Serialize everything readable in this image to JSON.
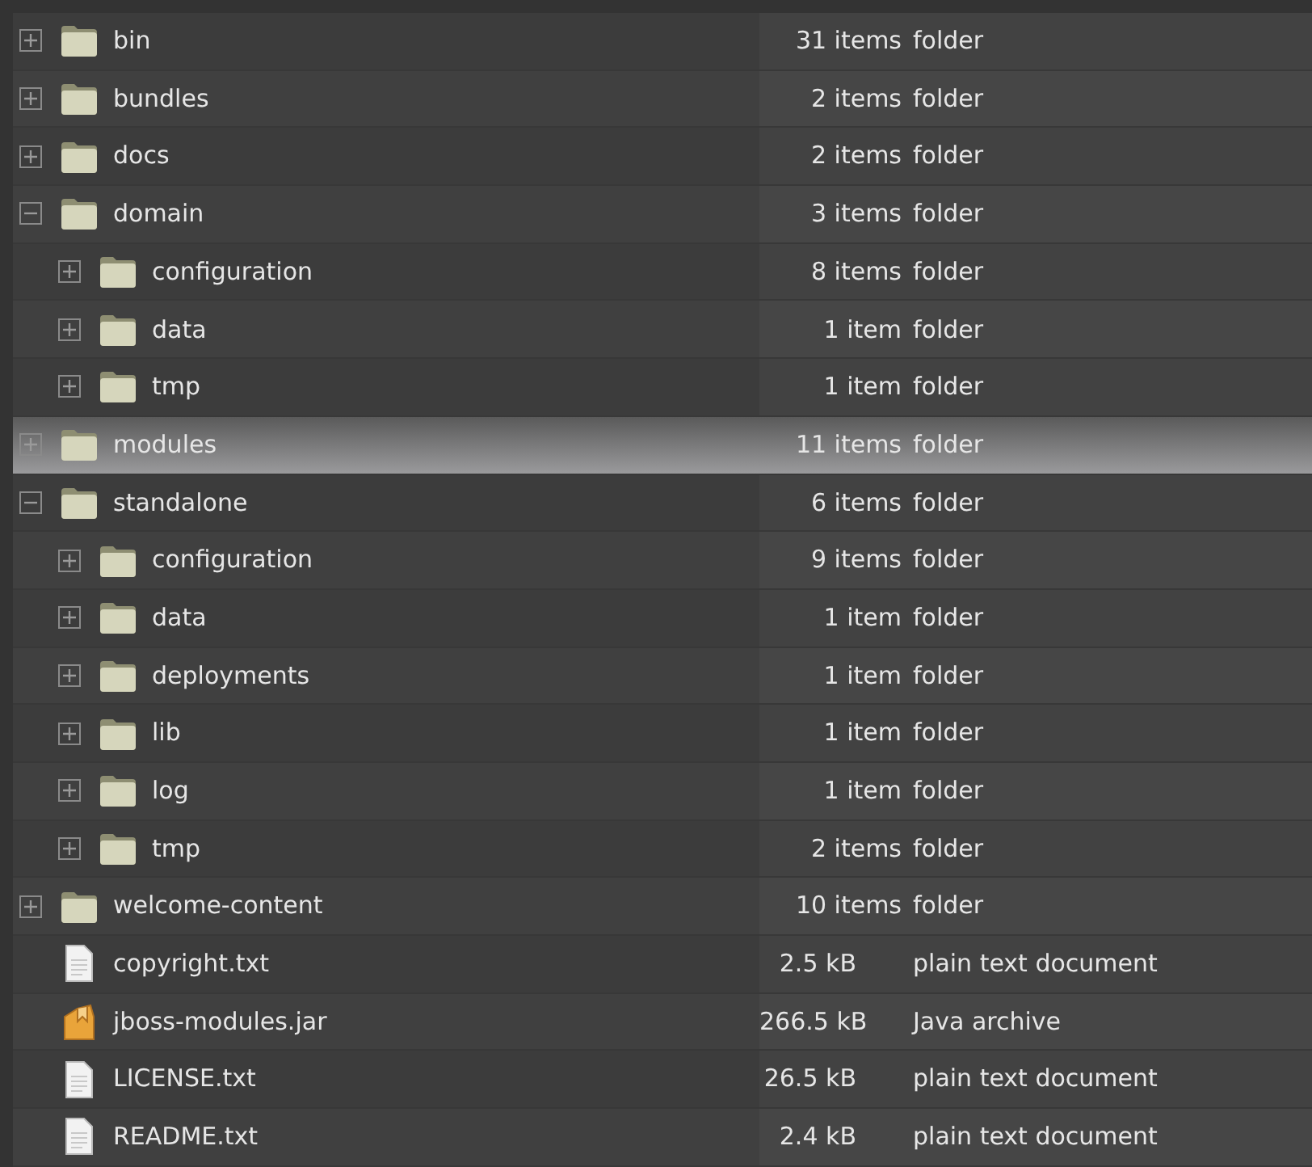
{
  "tree": [
    {
      "kind": "folder",
      "name": "bin",
      "size": "31 items",
      "type": "folder",
      "expanded": false,
      "selected": false
    },
    {
      "kind": "folder",
      "name": "bundles",
      "size": "2 items",
      "type": "folder",
      "expanded": false,
      "selected": false
    },
    {
      "kind": "folder",
      "name": "docs",
      "size": "2 items",
      "type": "folder",
      "expanded": false,
      "selected": false
    },
    {
      "kind": "folder",
      "name": "domain",
      "size": "3 items",
      "type": "folder",
      "expanded": true,
      "selected": false,
      "children": [
        {
          "kind": "folder",
          "name": "configuration",
          "size": "8 items",
          "type": "folder",
          "expanded": false,
          "selected": false
        },
        {
          "kind": "folder",
          "name": "data",
          "size": "1 item",
          "type": "folder",
          "expanded": false,
          "selected": false
        },
        {
          "kind": "folder",
          "name": "tmp",
          "size": "1 item",
          "type": "folder",
          "expanded": false,
          "selected": false
        }
      ]
    },
    {
      "kind": "folder",
      "name": "modules",
      "size": "11 items",
      "type": "folder",
      "expanded": false,
      "selected": true
    },
    {
      "kind": "folder",
      "name": "standalone",
      "size": "6 items",
      "type": "folder",
      "expanded": true,
      "selected": false,
      "children": [
        {
          "kind": "folder",
          "name": "configuration",
          "size": "9 items",
          "type": "folder",
          "expanded": false,
          "selected": false
        },
        {
          "kind": "folder",
          "name": "data",
          "size": "1 item",
          "type": "folder",
          "expanded": false,
          "selected": false
        },
        {
          "kind": "folder",
          "name": "deployments",
          "size": "1 item",
          "type": "folder",
          "expanded": false,
          "selected": false
        },
        {
          "kind": "folder",
          "name": "lib",
          "size": "1 item",
          "type": "folder",
          "expanded": false,
          "selected": false
        },
        {
          "kind": "folder",
          "name": "log",
          "size": "1 item",
          "type": "folder",
          "expanded": false,
          "selected": false
        },
        {
          "kind": "folder",
          "name": "tmp",
          "size": "2 items",
          "type": "folder",
          "expanded": false,
          "selected": false
        }
      ]
    },
    {
      "kind": "folder",
      "name": "welcome-content",
      "size": "10 items",
      "type": "folder",
      "expanded": false,
      "selected": false
    },
    {
      "kind": "text",
      "name": "copyright.txt",
      "size": "2.5 kB",
      "type": "plain text document",
      "selected": false
    },
    {
      "kind": "archive",
      "name": "jboss-modules.jar",
      "size": "266.5 kB",
      "type": "Java archive",
      "selected": false
    },
    {
      "kind": "text",
      "name": "LICENSE.txt",
      "size": "26.5 kB",
      "type": "plain text document",
      "selected": false
    },
    {
      "kind": "text",
      "name": "README.txt",
      "size": "2.4 kB",
      "type": "plain text document",
      "selected": false
    }
  ]
}
